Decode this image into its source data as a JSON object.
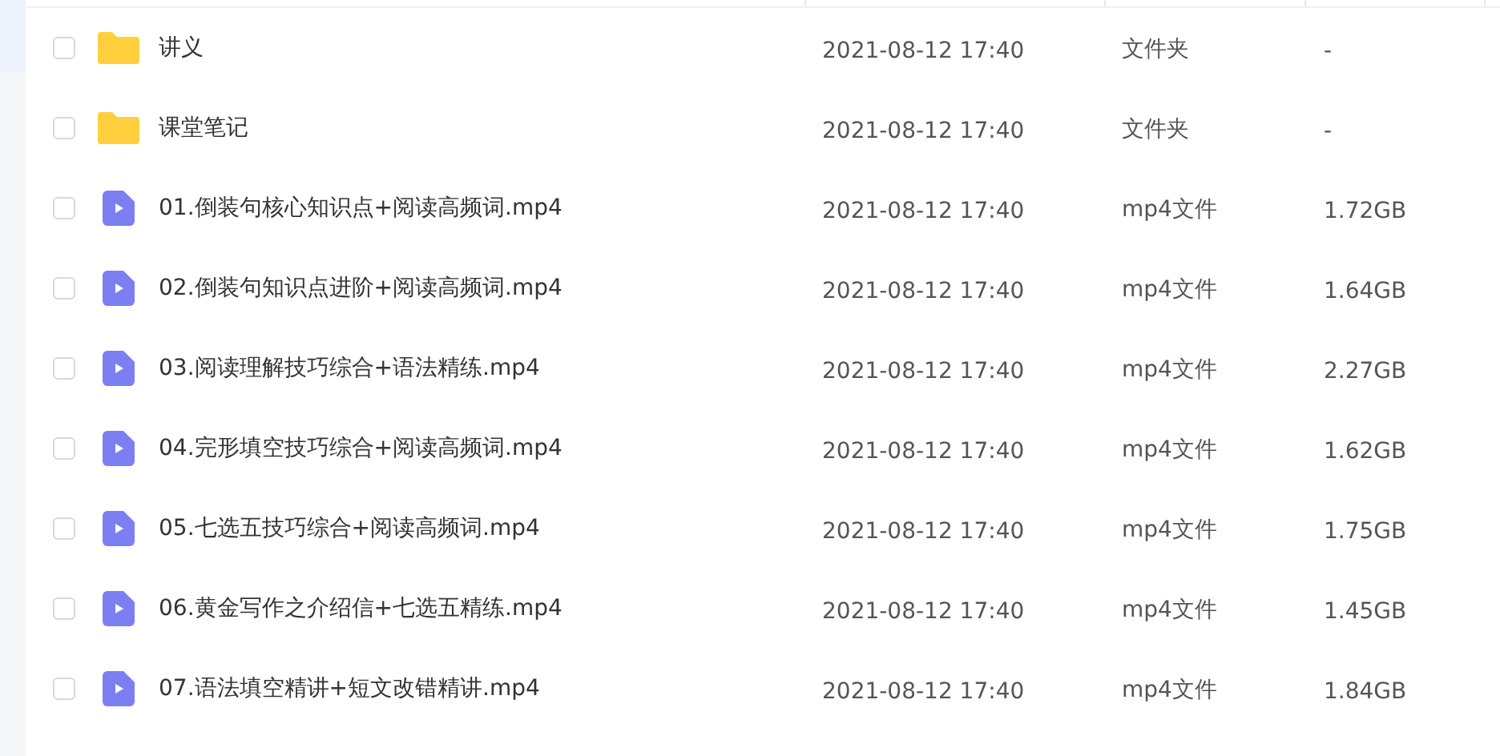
{
  "files": [
    {
      "kind": "folder",
      "name": "讲义",
      "modified": "2021-08-12 17:40",
      "type": "文件夹",
      "size": "-",
      "checked": false
    },
    {
      "kind": "folder",
      "name": "课堂笔记",
      "modified": "2021-08-12 17:40",
      "type": "文件夹",
      "size": "-",
      "checked": false
    },
    {
      "kind": "video",
      "name": "01.倒装句核心知识点+阅读高频词.mp4",
      "modified": "2021-08-12 17:40",
      "type": "mp4文件",
      "size": "1.72GB",
      "checked": false
    },
    {
      "kind": "video",
      "name": "02.倒装句知识点进阶+阅读高频词.mp4",
      "modified": "2021-08-12 17:40",
      "type": "mp4文件",
      "size": "1.64GB",
      "checked": false
    },
    {
      "kind": "video",
      "name": "03.阅读理解技巧综合+语法精练.mp4",
      "modified": "2021-08-12 17:40",
      "type": "mp4文件",
      "size": "2.27GB",
      "checked": false
    },
    {
      "kind": "video",
      "name": "04.完形填空技巧综合+阅读高频词.mp4",
      "modified": "2021-08-12 17:40",
      "type": "mp4文件",
      "size": "1.62GB",
      "checked": false
    },
    {
      "kind": "video",
      "name": "05.七选五技巧综合+阅读高频词.mp4",
      "modified": "2021-08-12 17:40",
      "type": "mp4文件",
      "size": "1.75GB",
      "checked": false
    },
    {
      "kind": "video",
      "name": "06.黄金写作之介绍信+七选五精练.mp4",
      "modified": "2021-08-12 17:40",
      "type": "mp4文件",
      "size": "1.45GB",
      "checked": false
    },
    {
      "kind": "video",
      "name": "07.语法填空精讲+短文改错精讲.mp4",
      "modified": "2021-08-12 17:40",
      "type": "mp4文件",
      "size": "1.84GB",
      "checked": false
    }
  ]
}
